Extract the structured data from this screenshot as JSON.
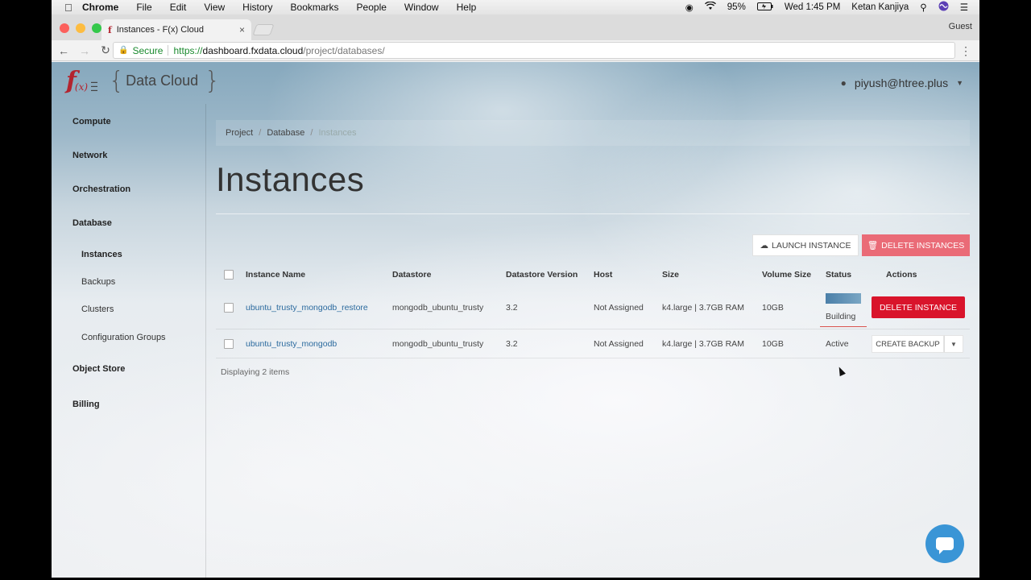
{
  "menubar": {
    "apple": "",
    "app": "Chrome",
    "items": [
      "File",
      "Edit",
      "View",
      "History",
      "Bookmarks",
      "People",
      "Window",
      "Help"
    ],
    "battery": "95%",
    "clock": "Wed 1:45 PM",
    "user": "Ketan Kanjiya"
  },
  "browser": {
    "tab_title": "Instances - F(x) Cloud",
    "guest_label": "Guest",
    "secure_label": "Secure",
    "url_scheme": "https://",
    "url_host": "dashboard.fxdata.cloud",
    "url_path": "/project/databases/"
  },
  "brand": {
    "logo_mark": "f",
    "logo_sub": "(x)",
    "name": "Data Cloud",
    "user": "piyush@htree.plus"
  },
  "sidebar": {
    "sections": [
      "Compute",
      "Network",
      "Orchestration",
      "Database",
      "Object Store",
      "Billing"
    ],
    "database_items": [
      "Instances",
      "Backups",
      "Clusters",
      "Configuration Groups"
    ],
    "active": "Instances"
  },
  "breadcrumb": [
    "Project",
    "Database",
    "Instances"
  ],
  "page_title": "Instances",
  "actions": {
    "launch": "LAUNCH INSTANCE",
    "delete_all": "DELETE INSTANCES"
  },
  "table": {
    "columns": [
      "Instance Name",
      "Datastore",
      "Datastore Version",
      "Host",
      "Size",
      "Volume Size",
      "Status",
      "Actions"
    ],
    "rows": [
      {
        "name": "ubuntu_trusty_mongodb_restore",
        "datastore": "mongodb_ubuntu_trusty",
        "version": "3.2",
        "host": "Not Assigned",
        "size": "k4.large | 3.7GB RAM",
        "volume": "10GB",
        "status": "Building",
        "action": "DELETE INSTANCE"
      },
      {
        "name": "ubuntu_trusty_mongodb",
        "datastore": "mongodb_ubuntu_trusty",
        "version": "3.2",
        "host": "Not Assigned",
        "size": "k4.large | 3.7GB RAM",
        "volume": "10GB",
        "status": "Active",
        "action": "CREATE BACKUP"
      }
    ],
    "footer": "Displaying 2 items"
  },
  "colors": {
    "brand_red": "#b3242f",
    "link": "#2b6a9e",
    "danger": "#d9142b",
    "danger_light": "#ea6b77",
    "chat": "#3a95d6"
  }
}
